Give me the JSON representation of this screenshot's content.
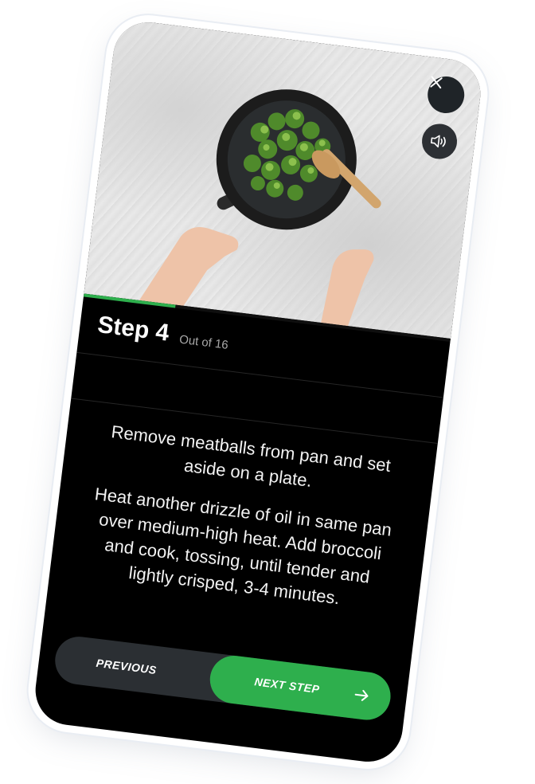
{
  "close_icon": "close-icon",
  "progress": {
    "current_step": 4,
    "total_steps": 16,
    "fraction": 0.25,
    "color": "#2eaf4d"
  },
  "step": {
    "title": "Step 4",
    "count": "Out of 16"
  },
  "audio_icon": "speaker-icon",
  "instructions": [
    "Remove meatballs from pan and set aside on a plate.",
    "Heat another drizzle of oil in same pan over medium-high heat. Add broccoli and cook, tossing, until tender and lightly crisped, 3-4 minutes."
  ],
  "nav": {
    "previous_label": "PREVIOUS",
    "next_label": "NEXT STEP",
    "next_icon": "arrow-right-icon",
    "accent": "#2eaf4d"
  }
}
